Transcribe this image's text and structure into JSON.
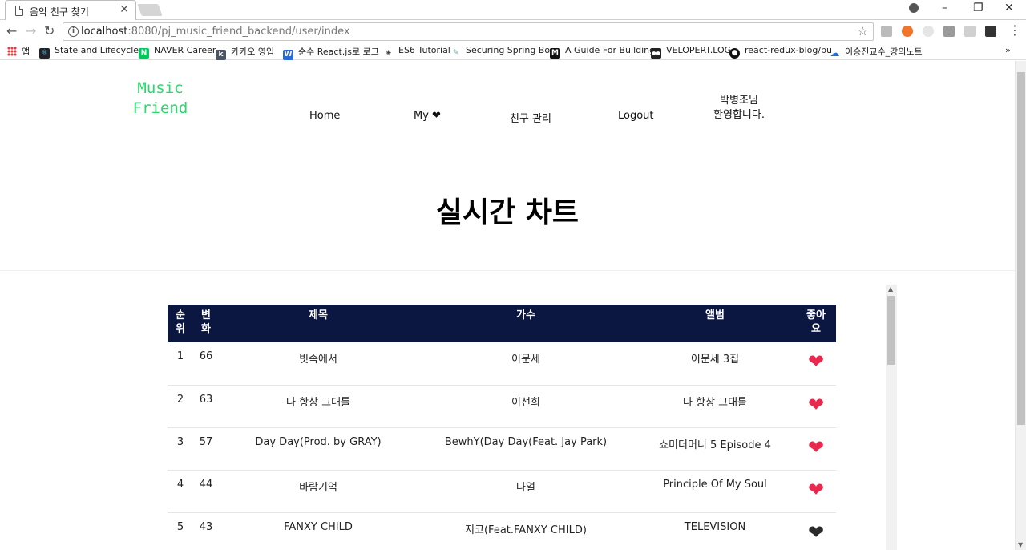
{
  "browser": {
    "tab_title": "음악 친구 찾기",
    "url_host": "localhost",
    "url_rest": ":8080/pj_music_friend_backend/user/index",
    "bookmarks": [
      {
        "label": "앱"
      },
      {
        "label": "State and Lifecycle -"
      },
      {
        "label": "NAVER Career"
      },
      {
        "label": "카카오 영입"
      },
      {
        "label": "순수 React.js로 로그"
      },
      {
        "label": "ES6 Tutorial"
      },
      {
        "label": "Securing Spring Boo"
      },
      {
        "label": "A Guide For Building"
      },
      {
        "label": "VELOPERT.LOG"
      },
      {
        "label": "react-redux-blog/pu"
      },
      {
        "label": "이승진교수_강의노트"
      }
    ],
    "more_bookmarks": "»"
  },
  "header": {
    "logo_line1": "Music",
    "logo_line2": "Friend",
    "nav": {
      "home": "Home",
      "my": "My ❤",
      "friends": "친구 관리",
      "logout": "Logout"
    },
    "welcome_line1": "박병조님",
    "welcome_line2": "환영합니다."
  },
  "page_title": "실시간 차트",
  "table": {
    "headers": {
      "rank": [
        "순",
        "위"
      ],
      "change": [
        "변",
        "화"
      ],
      "title": "제목",
      "artist": "가수",
      "album": "앨범",
      "like": [
        "좋아",
        "요"
      ]
    },
    "rows": [
      {
        "rank": "1",
        "change": "66",
        "title": "빗속에서",
        "artist": "이문세",
        "album": "이문세 3집",
        "liked": true
      },
      {
        "rank": "2",
        "change": "63",
        "title": "나 항상 그대를",
        "artist": "이선희",
        "album": "나 항상 그대를",
        "liked": true
      },
      {
        "rank": "3",
        "change": "57",
        "title": "Day Day(Prod. by GRAY)",
        "artist": "BewhY(Day Day(Feat. Jay Park)",
        "album": "쇼미더머니 5 Episode 4",
        "liked": true
      },
      {
        "rank": "4",
        "change": "44",
        "title": "바람기억",
        "artist": "나얼",
        "album": "Principle Of My Soul",
        "liked": true
      },
      {
        "rank": "5",
        "change": "43",
        "title": "FANXY CHILD",
        "artist": "지코(Feat.FANXY CHILD)",
        "album": "TELEVISION",
        "liked": false
      }
    ]
  },
  "colors": {
    "header_bg": "#0b1740",
    "logo": "#2bd86a",
    "liked": "#e8284d",
    "unliked": "#2a2a2a"
  }
}
